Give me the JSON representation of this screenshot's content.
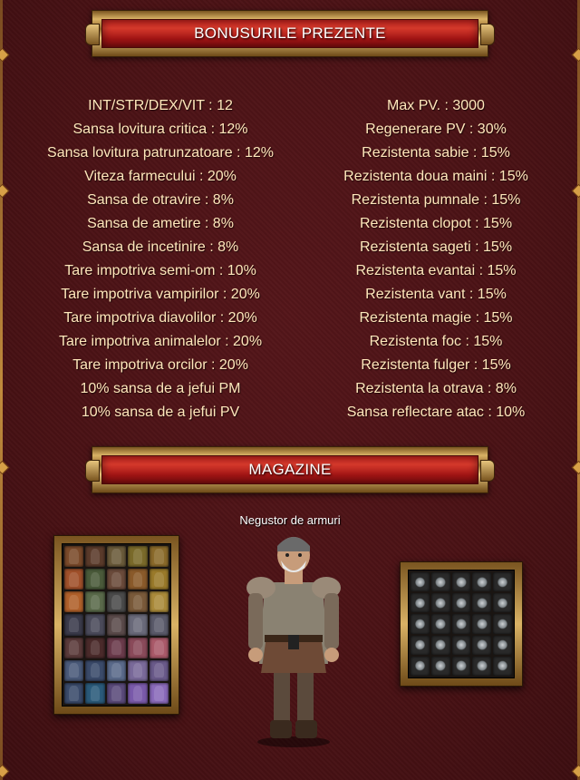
{
  "sections": {
    "bonuses_title": "BONUSURILE PREZENTE",
    "shops_title": "MAGAZINE"
  },
  "bonuses": {
    "left": [
      "INT/STR/DEX/VIT : 12",
      "Sansa lovitura critica : 12%",
      "Sansa lovitura patrunzatoare : 12%",
      "Viteza farmecului : 20%",
      "Sansa de otravire : 8%",
      "Sansa de ametire : 8%",
      "Sansa de incetinire : 8%",
      "Tare impotriva semi-om : 10%",
      "Tare impotriva vampirilor : 20%",
      "Tare impotriva diavolilor : 20%",
      "Tare impotriva animalelor : 20%",
      "Tare impotriva orcilor : 20%",
      "10% sansa de a jefui PM",
      "10% sansa de a jefui PV"
    ],
    "right": [
      "Max PV. : 3000",
      "Regenerare PV : 30%",
      "Rezistenta sabie : 15%",
      "Rezistenta doua maini : 15%",
      "Rezistenta pumnale : 15%",
      "Rezistenta clopot : 15%",
      "Rezistenta sageti : 15%",
      "Rezistenta evantai : 15%",
      "Rezistenta vant : 15%",
      "Rezistenta magie : 15%",
      "Rezistenta foc : 15%",
      "Rezistenta fulger : 15%",
      "Rezistenta la otrava : 8%",
      "Sansa reflectare atac : 10%"
    ]
  },
  "shop": {
    "npc_name": "Negustor de armuri",
    "armor_slot_colors": [
      "#7a4a2a",
      "#5a3a2a",
      "#6a5a3a",
      "#7a6a2a",
      "#8a6a2a",
      "#a0502a",
      "#4a5a3a",
      "#6a4a3a",
      "#8a5a2a",
      "#9a7a2a",
      "#b0602a",
      "#5a6a4a",
      "#4a4a4a",
      "#7a5a3a",
      "#aa8a3a",
      "#3a3a4a",
      "#4a4a5a",
      "#5a4a4a",
      "#6a6a7a",
      "#5a5a6a",
      "#5a3a3a",
      "#4a2a2a",
      "#6a3a4a",
      "#8a4a5a",
      "#aa5a6a",
      "#4a5a7a",
      "#3a4a6a",
      "#5a6a8a",
      "#7a6a9a",
      "#6a5a8a",
      "#3a4a6a",
      "#2a5a7a",
      "#5a4a7a",
      "#7a5aaa",
      "#8a6aba"
    ],
    "accessory_slot_count": 25
  },
  "colors": {
    "background": "#4a1215",
    "banner_red": "#c2221e",
    "frame_gold": "#d9b265",
    "stat_text": "#ffe7bb"
  }
}
